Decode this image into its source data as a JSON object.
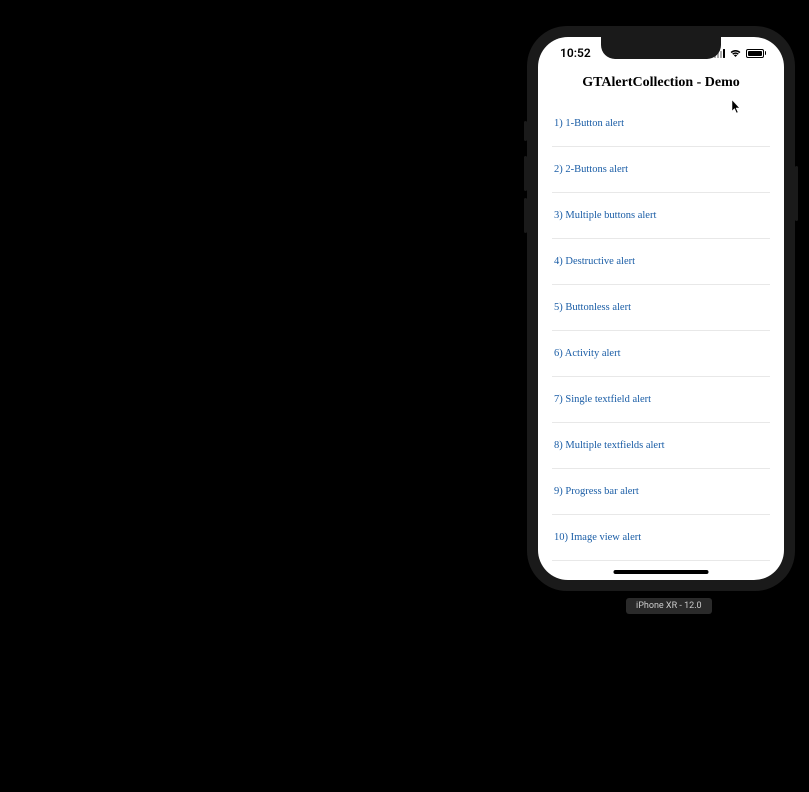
{
  "status_bar": {
    "time": "10:52"
  },
  "nav": {
    "title": "GTAlertCollection - Demo"
  },
  "list": {
    "items": [
      {
        "label": "1) 1-Button alert"
      },
      {
        "label": "2) 2-Buttons alert"
      },
      {
        "label": "3) Multiple buttons alert"
      },
      {
        "label": "4) Destructive alert"
      },
      {
        "label": "5) Buttonless alert"
      },
      {
        "label": "6) Activity alert"
      },
      {
        "label": "7) Single textfield alert"
      },
      {
        "label": "8) Multiple textfields alert"
      },
      {
        "label": "9) Progress bar alert"
      },
      {
        "label": "10) Image view alert"
      }
    ]
  },
  "simulator": {
    "device_label": "iPhone XR - 12.0"
  }
}
